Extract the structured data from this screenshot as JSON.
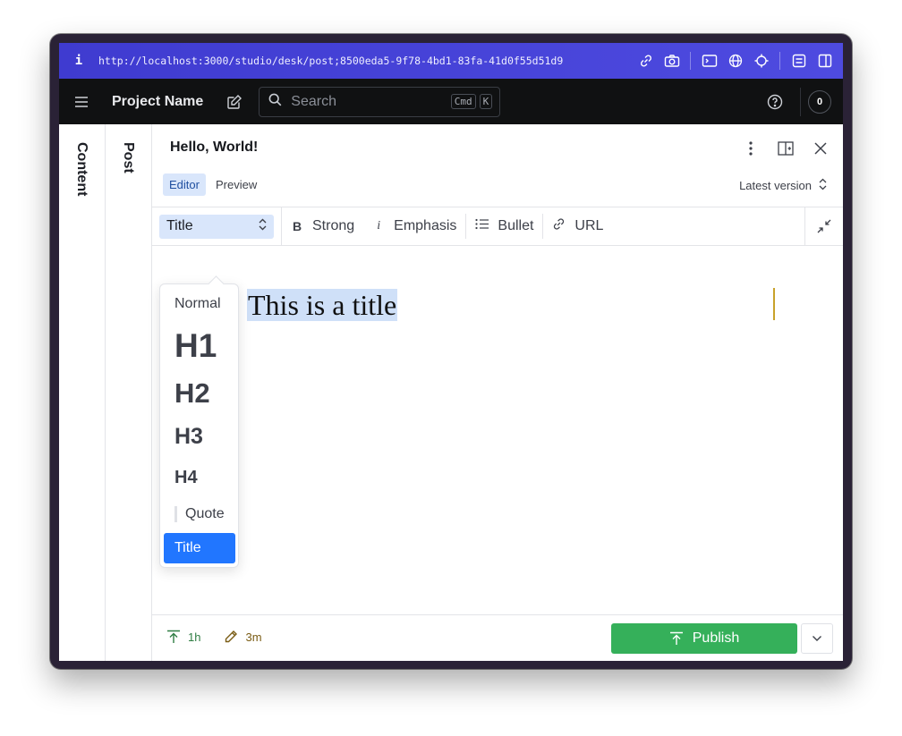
{
  "browser": {
    "url": "http://localhost:3000/studio/desk/post;8500eda5-9f78-4bd1-83fa-41d0f55d51d9",
    "info_glyph": "i"
  },
  "app": {
    "project_name": "Project Name",
    "search": {
      "placeholder": "Search",
      "shortcut_mod": "Cmd",
      "shortcut_key": "K"
    },
    "notification_count": "0"
  },
  "rails": {
    "content_label": "Content",
    "post_label": "Post"
  },
  "document": {
    "title": "Hello, World!",
    "tabs": [
      {
        "label": "Editor",
        "active": true
      },
      {
        "label": "Preview",
        "active": false
      }
    ],
    "version_label": "Latest version"
  },
  "toolbar": {
    "style_value": "Title",
    "strong": {
      "glyph": "B",
      "label": "Strong"
    },
    "emphasis": {
      "glyph": "i",
      "label": "Emphasis"
    },
    "bullet": {
      "label": "Bullet"
    },
    "url": {
      "label": "URL"
    }
  },
  "style_menu": {
    "items": [
      "Normal",
      "H1",
      "H2",
      "H3",
      "H4",
      "Quote",
      "Title"
    ],
    "selected": "Title"
  },
  "editor": {
    "content": "This is a title"
  },
  "footer": {
    "published_ago": "1h",
    "edited_ago": "3m",
    "publish_label": "Publish"
  },
  "colors": {
    "accent": "#2176ff",
    "publish": "#35b05a",
    "selection": "#cfe0f8",
    "urlbar": "#4845d8"
  }
}
